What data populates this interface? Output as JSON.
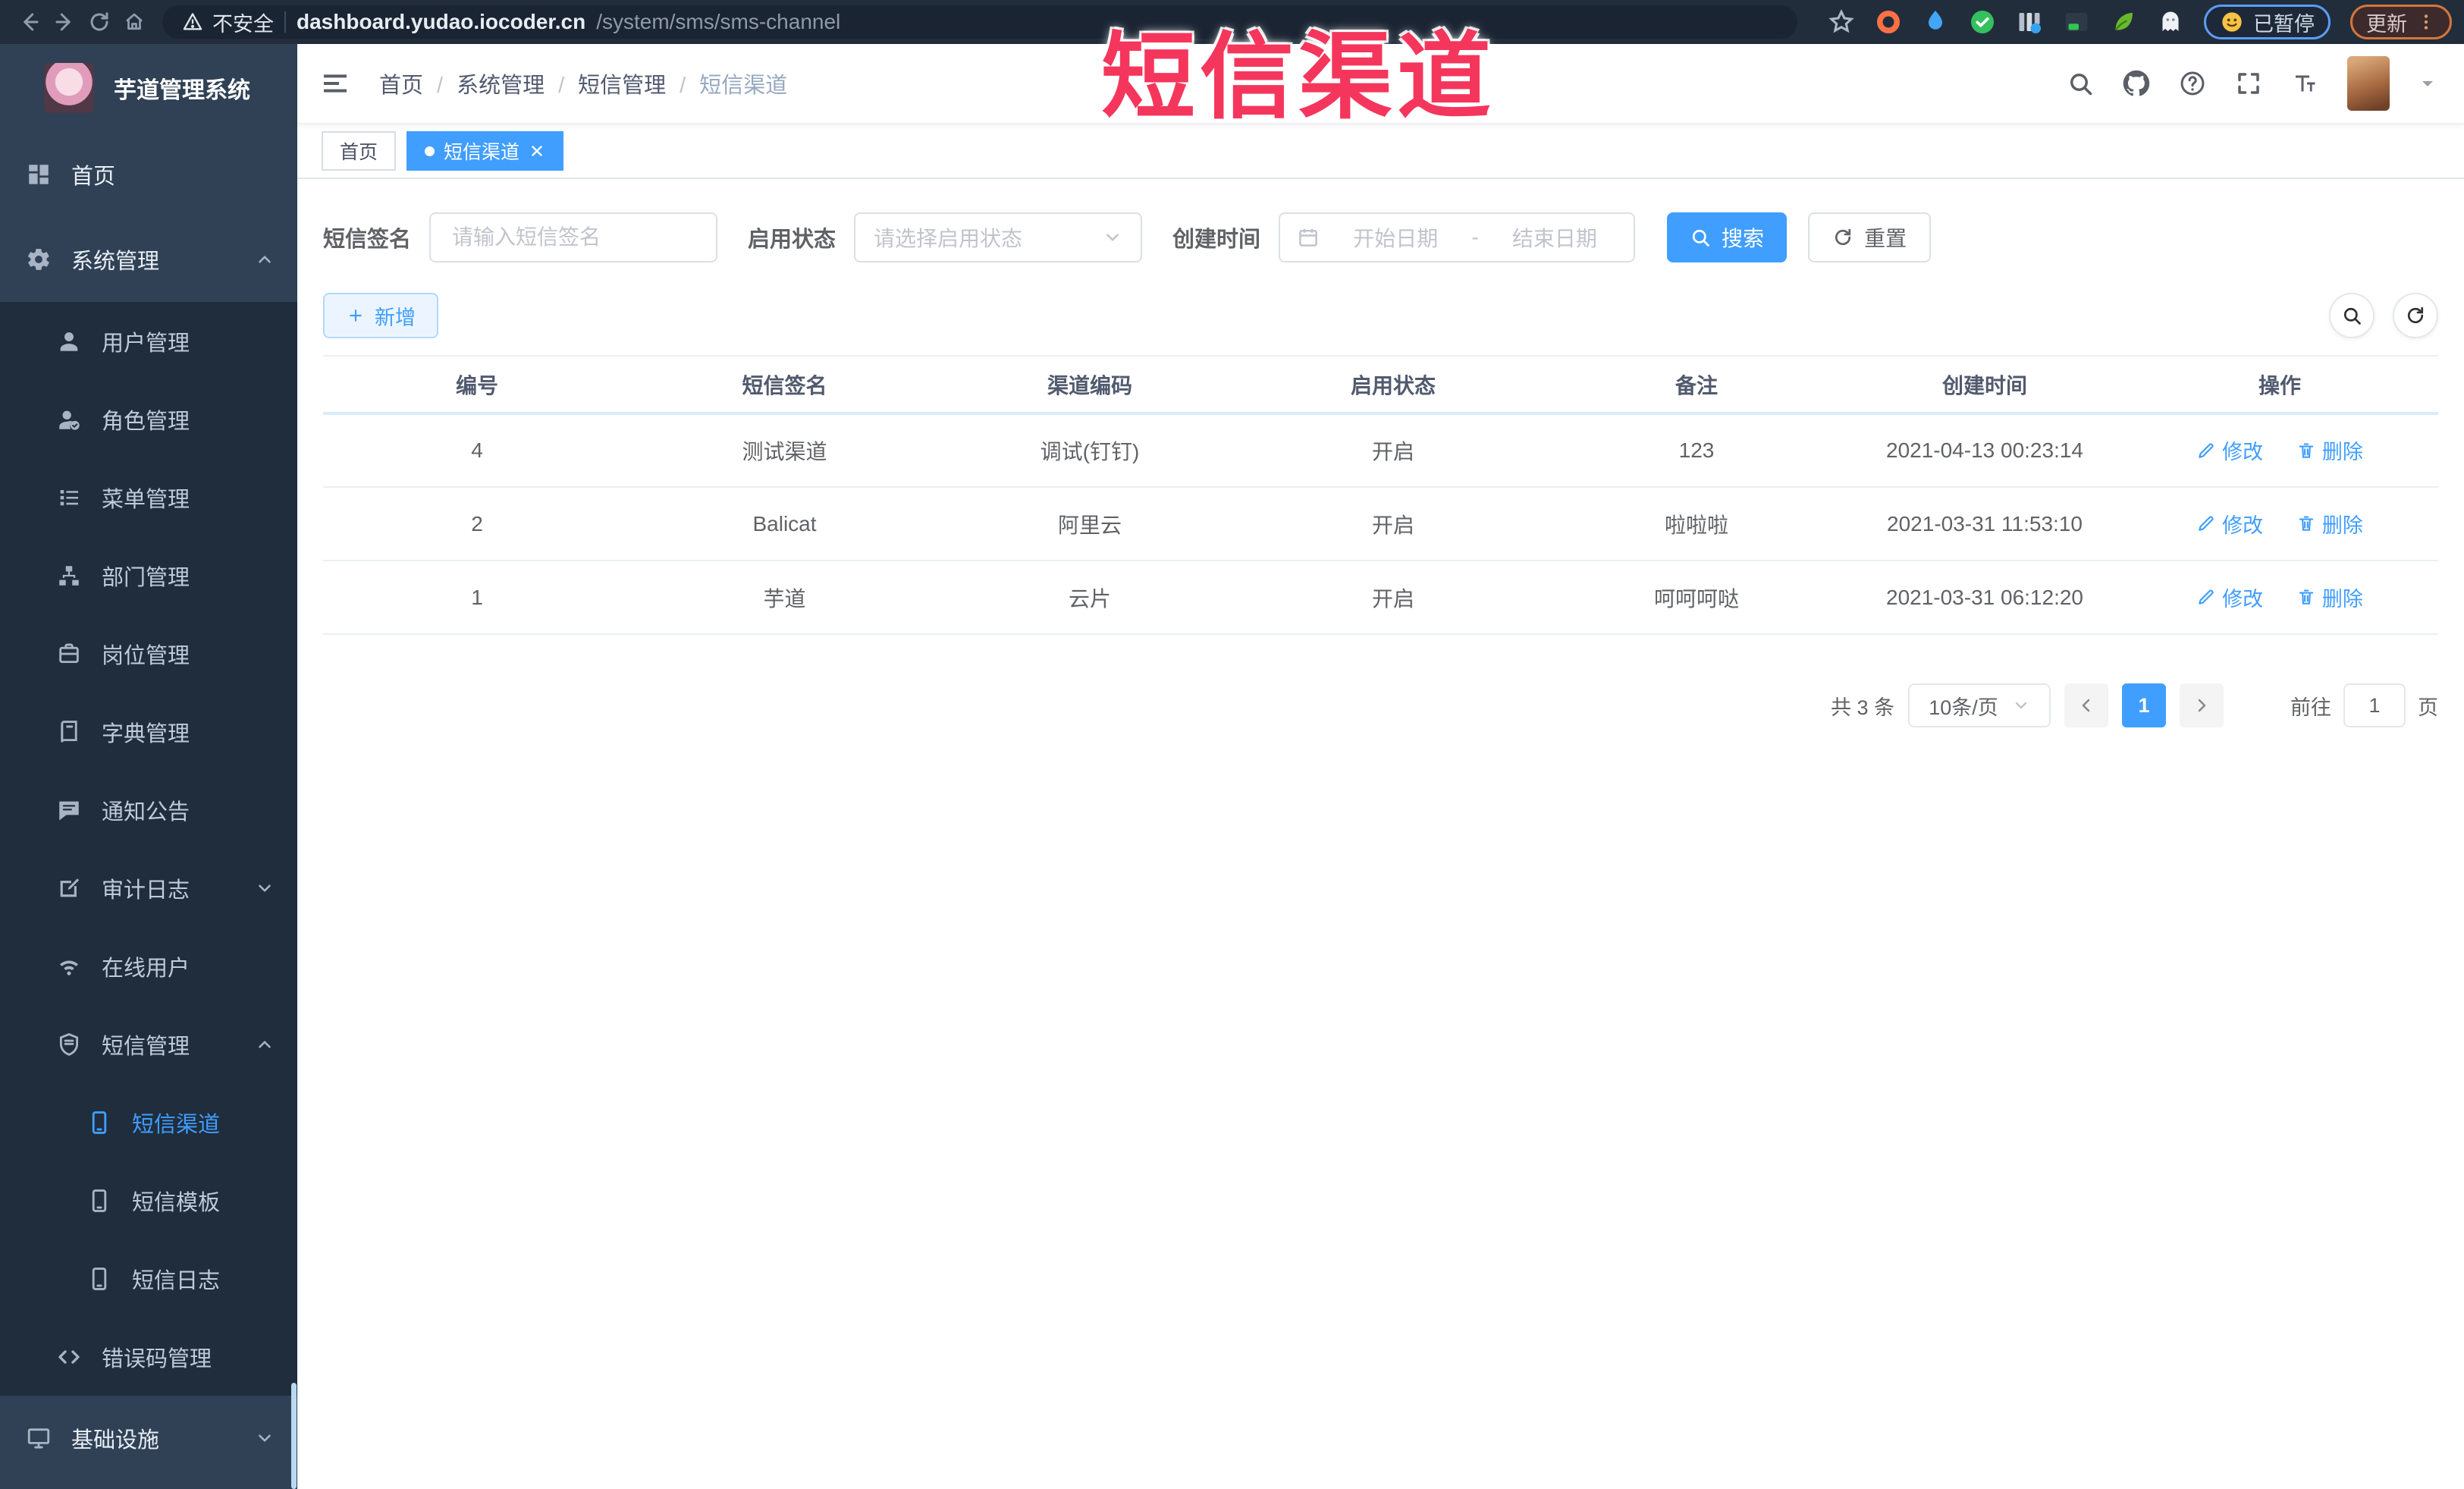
{
  "browser": {
    "security_label": "不安全",
    "url_host": "dashboard.yudao.iocoder.cn",
    "url_path": "/system/sms/sms-channel",
    "extensions": [
      {
        "icon": "adblock-icon"
      },
      {
        "icon": "pin-icon"
      },
      {
        "icon": "shield-check-icon"
      },
      {
        "icon": "columns-icon"
      },
      {
        "icon": "switch-icon"
      },
      {
        "icon": "leaf-icon"
      },
      {
        "icon": "ghost-icon"
      }
    ],
    "paused_label": "已暂停",
    "update_label": "更新"
  },
  "overlay": {
    "title": "短信渠道",
    "color": "#f5365c"
  },
  "sidebar": {
    "logo_title": "芋道管理系统",
    "items": [
      {
        "label": "首页",
        "icon": "dashboard-icon",
        "level": 1
      },
      {
        "label": "系统管理",
        "icon": "gear-icon",
        "level": 1,
        "arrow": "up"
      },
      {
        "label": "用户管理",
        "icon": "user-icon",
        "level": 2
      },
      {
        "label": "角色管理",
        "icon": "role-icon",
        "level": 2
      },
      {
        "label": "菜单管理",
        "icon": "menu-list-icon",
        "level": 2
      },
      {
        "label": "部门管理",
        "icon": "dept-icon",
        "level": 2
      },
      {
        "label": "岗位管理",
        "icon": "post-icon",
        "level": 2
      },
      {
        "label": "字典管理",
        "icon": "dict-icon",
        "level": 2
      },
      {
        "label": "通知公告",
        "icon": "notice-icon",
        "level": 2
      },
      {
        "label": "审计日志",
        "icon": "audit-icon",
        "level": 2,
        "arrow": "down"
      },
      {
        "label": "在线用户",
        "icon": "online-icon",
        "level": 2
      },
      {
        "label": "短信管理",
        "icon": "sms-icon",
        "level": 2,
        "arrow": "up"
      },
      {
        "label": "短信渠道",
        "icon": "phone-icon",
        "level": 3,
        "active": true
      },
      {
        "label": "短信模板",
        "icon": "phone-icon",
        "level": 3
      },
      {
        "label": "短信日志",
        "icon": "phone-icon",
        "level": 3
      },
      {
        "label": "错误码管理",
        "icon": "code-icon",
        "level": 2
      },
      {
        "label": "基础设施",
        "icon": "infra-icon",
        "level": 1,
        "arrow": "down"
      }
    ]
  },
  "navbar": {
    "breadcrumb": [
      "首页",
      "系统管理",
      "短信管理",
      "短信渠道"
    ]
  },
  "tags": [
    {
      "label": "首页"
    },
    {
      "label": "短信渠道",
      "active": true
    }
  ],
  "filters": {
    "signature_label": "短信签名",
    "signature_placeholder": "请输入短信签名",
    "status_label": "启用状态",
    "status_placeholder": "请选择启用状态",
    "created_label": "创建时间",
    "start_placeholder": "开始日期",
    "range_separator": "-",
    "end_placeholder": "结束日期",
    "search_label": "搜索",
    "reset_label": "重置"
  },
  "toolbar": {
    "add_label": "新增"
  },
  "table": {
    "columns": [
      "编号",
      "短信签名",
      "渠道编码",
      "启用状态",
      "备注",
      "创建时间",
      "操作"
    ],
    "rows": [
      {
        "id": "4",
        "signature": "测试渠道",
        "code": "调试(钉钉)",
        "status": "开启",
        "remark": "123",
        "created": "2021-04-13 00:23:14"
      },
      {
        "id": "2",
        "signature": "Balicat",
        "code": "阿里云",
        "status": "开启",
        "remark": "啦啦啦",
        "created": "2021-03-31 11:53:10"
      },
      {
        "id": "1",
        "signature": "芋道",
        "code": "云片",
        "status": "开启",
        "remark": "呵呵呵哒",
        "created": "2021-03-31 06:12:20"
      }
    ],
    "edit_label": "修改",
    "delete_label": "删除"
  },
  "pagination": {
    "total": "共 3 条",
    "page_size": "10条/页",
    "current": "1",
    "goto_label": "前往",
    "goto_value": "1",
    "unit_label": "页"
  },
  "colors": {
    "accent": "#409eff",
    "overlay": "#f5365c",
    "sidebar_bg": "#304156",
    "submenu_bg": "#1f2d3d"
  }
}
